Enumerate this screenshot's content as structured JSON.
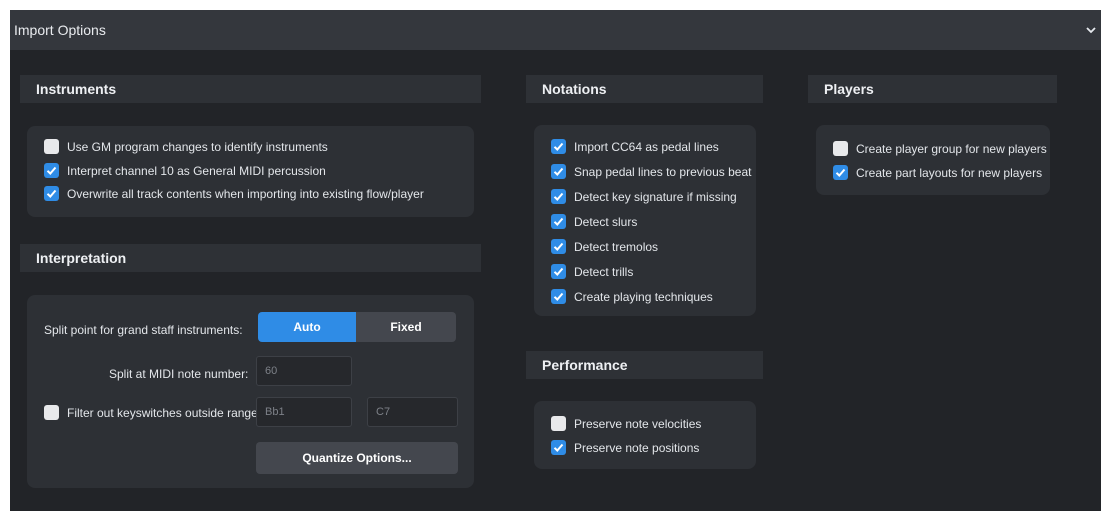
{
  "header": {
    "title": "Import Options",
    "collapse_icon": "chevron-down-icon"
  },
  "instruments": {
    "title": "Instruments",
    "options": [
      {
        "label": "Use GM program changes to identify instruments",
        "checked": false
      },
      {
        "label": "Interpret channel 10 as General MIDI percussion",
        "checked": true
      },
      {
        "label": "Overwrite all track contents when importing into existing flow/player",
        "checked": true
      }
    ]
  },
  "interpretation": {
    "title": "Interpretation",
    "split_point_label": "Split point for grand staff instruments:",
    "split_modes": [
      "Auto",
      "Fixed"
    ],
    "selected_mode": "Auto",
    "split_note_label": "Split at MIDI note number:",
    "split_note_value": "60",
    "filter_label": "Filter out keyswitches outside range:",
    "filter_checked": false,
    "range_low": "Bb1",
    "range_high": "C7",
    "quantize_button": "Quantize Options..."
  },
  "notations": {
    "title": "Notations",
    "options": [
      {
        "label": "Import CC64 as pedal lines",
        "checked": true
      },
      {
        "label": "Snap pedal lines to previous beat",
        "checked": true
      },
      {
        "label": "Detect key signature if missing",
        "checked": true
      },
      {
        "label": "Detect slurs",
        "checked": true
      },
      {
        "label": "Detect tremolos",
        "checked": true
      },
      {
        "label": "Detect trills",
        "checked": true
      },
      {
        "label": "Create playing techniques",
        "checked": true
      }
    ]
  },
  "performance": {
    "title": "Performance",
    "options": [
      {
        "label": "Preserve note velocities",
        "checked": false
      },
      {
        "label": "Preserve note positions",
        "checked": true
      }
    ]
  },
  "players": {
    "title": "Players",
    "options": [
      {
        "label": "Create player group for new players",
        "checked": false
      },
      {
        "label": "Create part layouts for new players",
        "checked": true
      }
    ]
  },
  "colors": {
    "accent": "#2f8ce6",
    "panel": "#222428",
    "header": "#34373d",
    "group": "#2d3035"
  }
}
